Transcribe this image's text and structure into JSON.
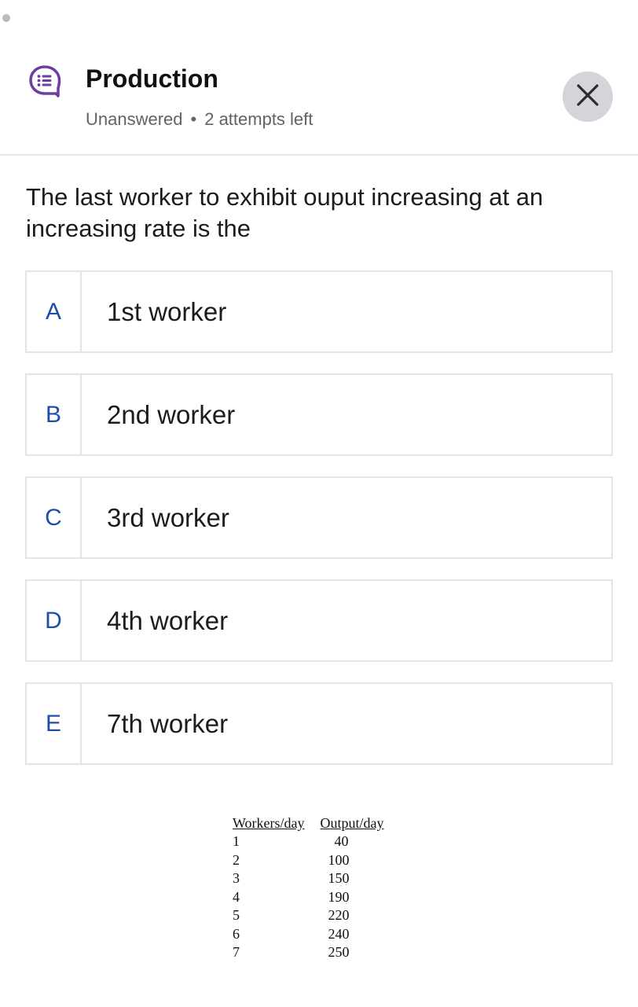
{
  "header": {
    "title": "Production",
    "status": "Unanswered",
    "separator": "•",
    "attempts": "2 attempts left",
    "icon": "quiz-chat-icon",
    "close_icon": "close-icon",
    "accent_color": "#6b3fa0"
  },
  "question": {
    "text": "The last worker to exhibit ouput increasing at an increasing rate is the"
  },
  "options": [
    {
      "letter": "A",
      "text": "1st worker"
    },
    {
      "letter": "B",
      "text": "2nd worker"
    },
    {
      "letter": "C",
      "text": "3rd worker"
    },
    {
      "letter": "D",
      "text": "4th worker"
    },
    {
      "letter": "E",
      "text": "7th worker"
    }
  ],
  "data_table": {
    "headers": [
      "Workers/day",
      "Output/day"
    ],
    "rows": [
      [
        "1",
        "40"
      ],
      [
        "2",
        "100"
      ],
      [
        "3",
        "150"
      ],
      [
        "4",
        "190"
      ],
      [
        "5",
        "220"
      ],
      [
        "6",
        "240"
      ],
      [
        "7",
        "250"
      ]
    ]
  }
}
